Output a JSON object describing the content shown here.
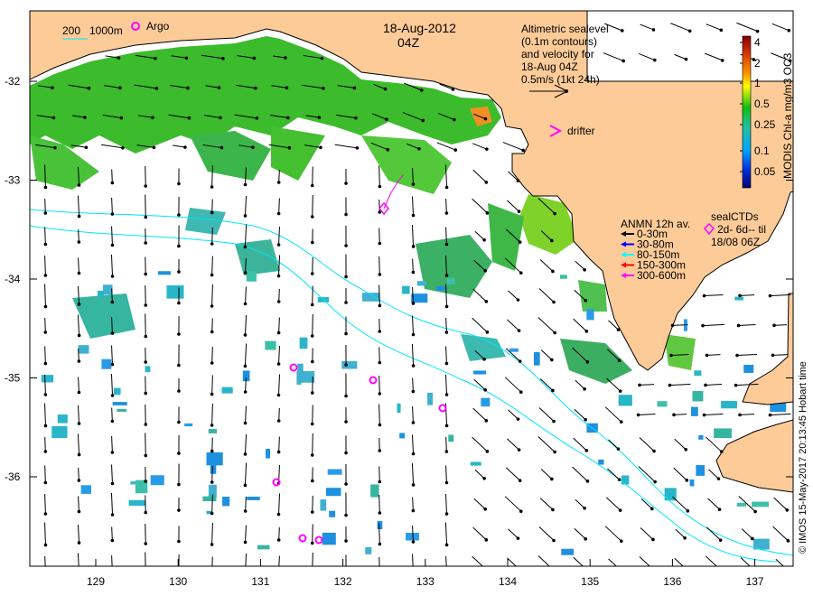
{
  "map": {
    "date_line1": "18-Aug-2012",
    "date_line2": "04Z",
    "scale_bar": {
      "label_200": "200",
      "label_1000": "1000m"
    },
    "argo_label": "Argo",
    "altimetry_note": [
      "Altimetric sealevel",
      "(0.1m contours)",
      "and velocity for",
      "18-Aug 04Z",
      "0.5m/s (1kt 24h)"
    ],
    "drifter_label": "drifter",
    "anmn_legend": {
      "title": "ANMN 12h av.",
      "items": [
        {
          "label": "0-30m",
          "color": "#000000"
        },
        {
          "label": "30-80m",
          "color": "#0000ff"
        },
        {
          "label": "80-150m",
          "color": "#00ffff"
        },
        {
          "label": "150-300m",
          "color": "#ff0000"
        },
        {
          "label": "300-600m",
          "color": "#ff00ff"
        }
      ]
    },
    "seal_legend": {
      "title": "sealCTDs",
      "line2": "2d- 6d-- til",
      "line3": "18/08 06Z"
    },
    "colorbar": {
      "label": "MODIS Chl-a mg/m3 OC3",
      "ticks": [
        "4",
        "2",
        "1",
        "0.5",
        "0.25",
        "0.1",
        "0.05"
      ]
    },
    "copyright": "© IMOS 15-May-2017 20:13:45 Hobart time",
    "x_ticks": [
      "129",
      "130",
      "131",
      "132",
      "133",
      "134",
      "135",
      "136",
      "137"
    ],
    "y_ticks": [
      "-32",
      "-33",
      "-34",
      "-35",
      "-36"
    ],
    "colors": {
      "land": "#fdcb98",
      "contour": "#00e5ff",
      "marker": "#ff00ff"
    }
  }
}
